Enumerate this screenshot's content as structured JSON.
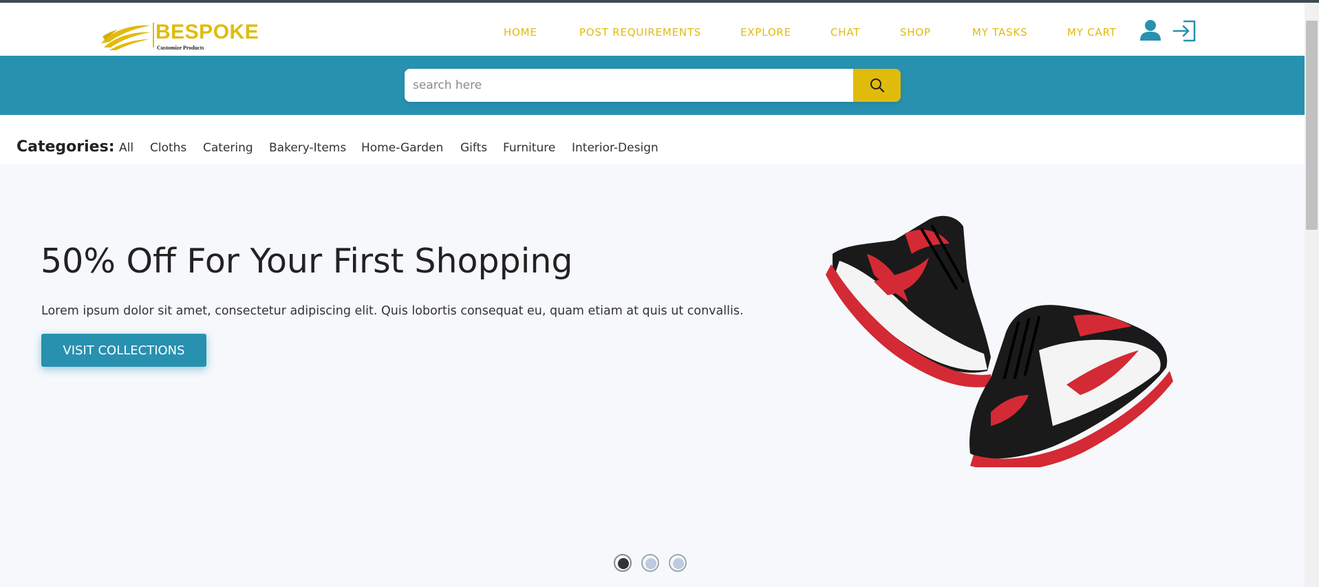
{
  "brand": {
    "name": "BESPOKE",
    "tagline": "Customize Products",
    "color": "#e0bb0b"
  },
  "nav": {
    "items": [
      {
        "label": "HOME"
      },
      {
        "label": "POST REQUIREMENTS"
      },
      {
        "label": "EXPLORE"
      },
      {
        "label": "CHAT"
      },
      {
        "label": "SHOP"
      },
      {
        "label": "MY TASKS"
      },
      {
        "label": "MY CART"
      }
    ],
    "user_icon": "user-icon",
    "login_icon": "sign-in-icon"
  },
  "search": {
    "placeholder": "search here",
    "value": "",
    "button_icon": "search-icon"
  },
  "categories": {
    "label": "Categories:",
    "items": [
      "All",
      "Cloths",
      "Catering",
      "Bakery-Items",
      "Home-Garden",
      "Gifts",
      "Furniture",
      "Interior-Design"
    ]
  },
  "hero": {
    "title": "50% Off For Your First Shopping",
    "text": "Lorem ipsum dolor sit amet, consectetur adipiscing elit. Quis lobortis consequat eu, quam etiam at quis ut convallis.",
    "button_label": "VISIT COLLECTIONS",
    "image": "red-black-sneakers",
    "slides": {
      "count": 3,
      "active": 1
    }
  },
  "colors": {
    "accent": "#2891b0",
    "brand_yellow": "#e0bb0b",
    "hero_bg": "#f6f8fc"
  }
}
